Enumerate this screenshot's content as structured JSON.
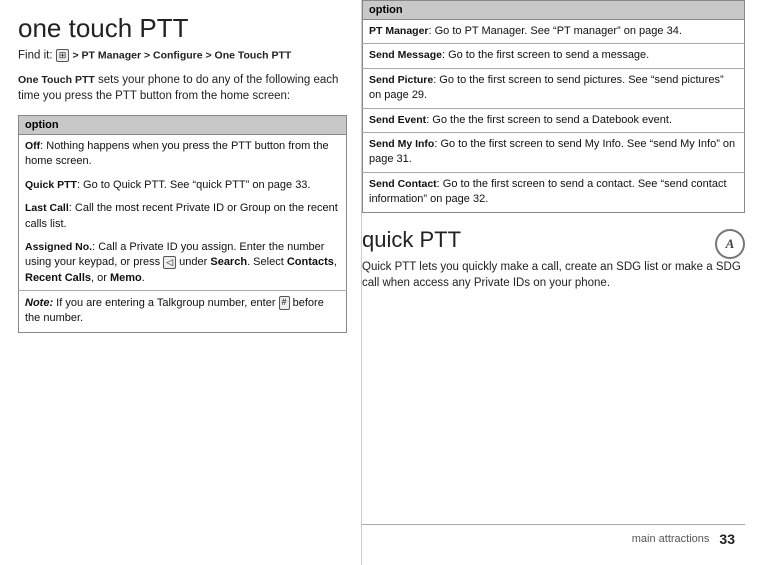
{
  "left": {
    "title": "one touch PTT",
    "find_it_label": "Find it:",
    "find_it_path": " > PT Manager > Configure > One Touch PTT",
    "find_it_icon": "⊞",
    "intro": {
      "term": "One Touch PTT",
      "text": " sets your phone to do any of the following each time you press the PTT button from the home screen:"
    },
    "table": {
      "header": "option",
      "rows": [
        {
          "term": "Off",
          "text": ": Nothing happens when you press the PTT button from the home screen."
        },
        {
          "term": "Quick PTT",
          "text": ": Go to Quick PTT. See “quick PTT” on page 33."
        },
        {
          "term": "Last Call",
          "text": ": Call the most recent Private ID or Group on the recent calls list."
        },
        {
          "term": "Assigned No.",
          "text": ": Call a Private ID you assign. Enter the number using your keypad, or press",
          "key": "◁",
          "text2": " under ",
          "bold2": "Search",
          "text3": ". Select ",
          "bold3": "Contacts",
          "text4": ", ",
          "bold4": "Recent Calls",
          "text5": ", or ",
          "bold5": "Memo",
          "text6": "."
        }
      ],
      "note": {
        "label": "Note:",
        "text": " If you are entering a Talkgroup number, enter ",
        "key": "#",
        "text2": " before the number."
      }
    }
  },
  "right": {
    "table": {
      "header": "option",
      "rows": [
        {
          "term": "PT Manager",
          "text": ": Go to PT Manager. See “PT manager” on page 34."
        },
        {
          "term": "Send Message",
          "text": ": Go to the first screen to send a message."
        },
        {
          "term": "Send Picture",
          "text": ": Go to the first screen to send pictures. See “send pictures” on page 29."
        },
        {
          "term": "Send Event",
          "text": ": Go the the first screen to send a Datebook event."
        },
        {
          "term": "Send My Info",
          "text": ": Go to the first screen to send My Info. See “send My Info” on page 31."
        },
        {
          "term": "Send Contact",
          "text": ": Go to the first screen to send a contact. See “send contact information” on page 32."
        }
      ]
    },
    "quick_ptt": {
      "title": "quick PTT",
      "icon_label": "A",
      "text": "Quick PTT lets you quickly make a call, create an SDG list or make a SDG call when access any Private IDs on your phone."
    },
    "footer": {
      "section": "main attractions",
      "page": "33"
    }
  }
}
